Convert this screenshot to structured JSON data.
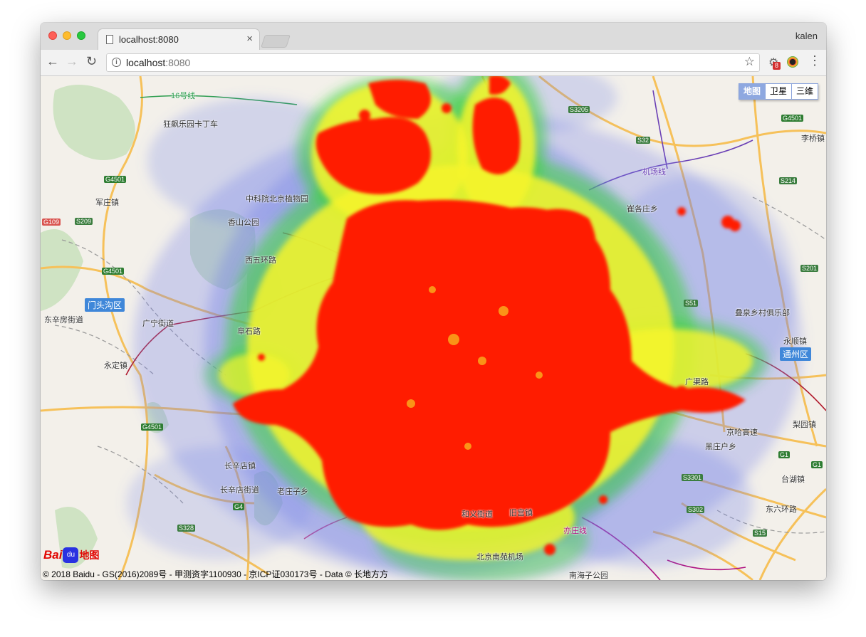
{
  "browser": {
    "tab_title": "localhost:8080",
    "tab_close": "×",
    "user_name": "kalen",
    "url_host": "localhost",
    "url_port": ":8080",
    "extension_badge": "8",
    "info_glyph": "i",
    "back_glyph": "←",
    "forward_glyph": "→",
    "reload_glyph": "↻",
    "star_glyph": "☆",
    "menu_glyph": "⋮"
  },
  "map": {
    "maptype_buttons": [
      "地图",
      "卫星",
      "三维"
    ],
    "active_maptype": "地图",
    "copyright": "© 2018 Baidu - GS(2016)2089号 - 甲测资字1100930 - 京ICP证030173号 - Data © 长地方方",
    "logo": {
      "bai": "Bai",
      "paw": "du",
      "ditu": "地图"
    },
    "districts": [
      "门头沟区",
      "通州区"
    ],
    "labels": [
      "狂飙乐园卡丁车",
      "16号线",
      "中科院北京植物园",
      "香山公园",
      "西五环路",
      "军庄镇",
      "东辛房街道",
      "广宁街道",
      "永定镇",
      "长辛店镇",
      "长辛店街道",
      "老庄子乡",
      "和义街道",
      "旧宫镇",
      "北京南苑机场",
      "南海子公园",
      "叠泉乡村俱乐部",
      "永顺镇",
      "黑庄户乡",
      "台湖镇",
      "梨园镇",
      "李桥镇",
      "机场线",
      "亦庄线",
      "京哈高速",
      "东六环路",
      "广渠路",
      "崔各庄乡",
      "阜石路",
      "卫星"
    ],
    "shields": [
      "G4501",
      "S3205",
      "S32",
      "G4501",
      "G109",
      "S209",
      "G4501",
      "S214",
      "S201",
      "S51",
      "G1",
      "S3301",
      "S302",
      "S15",
      "G4",
      "S328",
      "G4501",
      "G1"
    ],
    "colors": {
      "heat_core": "#ff1a00",
      "heat_mid": "#f7f52b",
      "heat_low": "#3dd43d",
      "heat_outer": "#6f7ee8",
      "land": "#f3f0ea",
      "forest": "#cfe3c3",
      "road": "#f6c15a",
      "district_badge": "#3f87d9"
    }
  }
}
